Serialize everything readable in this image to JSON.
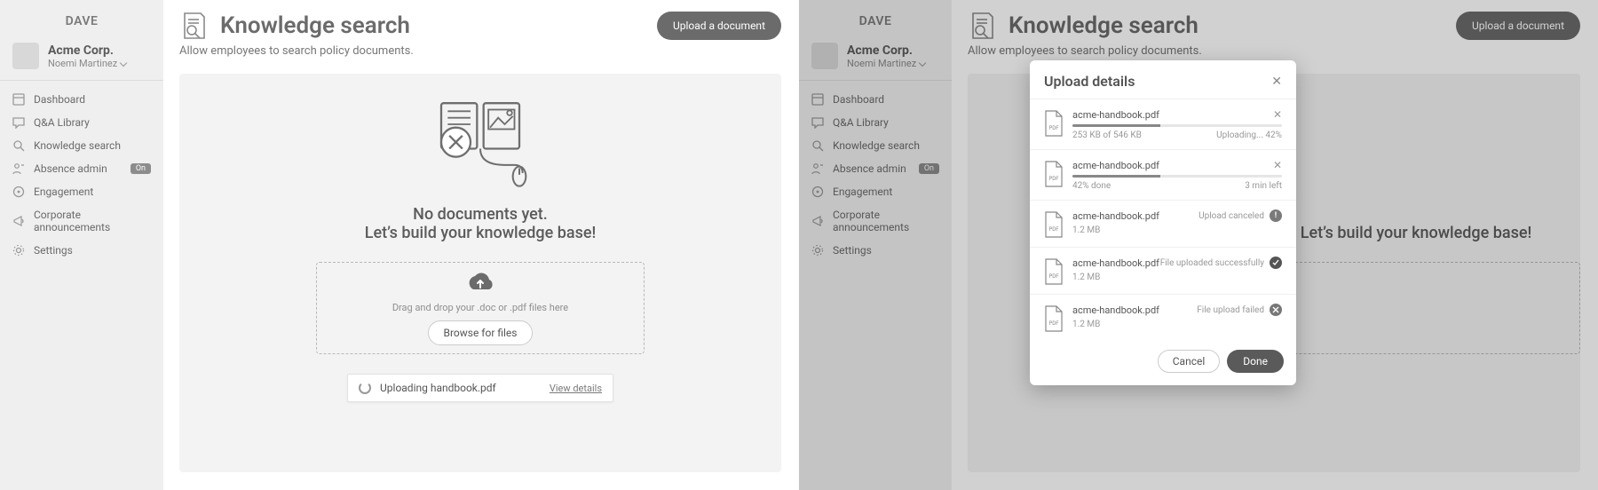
{
  "brand": "DAVE",
  "org": {
    "name": "Acme Corp.",
    "user": "Noemi Martinez"
  },
  "nav": [
    {
      "label": "Dashboard",
      "icon": "home-icon"
    },
    {
      "label": "Q&A Library",
      "icon": "qa-icon"
    },
    {
      "label": "Knowledge search",
      "icon": "search-icon"
    },
    {
      "label": "Absence admin",
      "icon": "absence-icon",
      "badge": "On"
    },
    {
      "label": "Engagement",
      "icon": "engagement-icon"
    },
    {
      "label": "Corporate announcements",
      "icon": "announcement-icon"
    },
    {
      "label": "Settings",
      "icon": "settings-icon"
    }
  ],
  "page": {
    "title": "Knowledge search",
    "upload_btn": "Upload a document",
    "subtitle": "Allow employees to search policy documents.",
    "empty_line1": "No documents yet.",
    "empty_line2": "Let’s build your knowledge base!",
    "dropzone_text": "Drag and drop your .doc or .pdf files here",
    "browse_btn": "Browse for files"
  },
  "uploading_toast": {
    "text": "Uploading handbook.pdf",
    "link": "View details"
  },
  "modal": {
    "title": "Upload details",
    "cancel": "Cancel",
    "done": "Done",
    "rows": [
      {
        "name": "acme-handbook.pdf",
        "progress": 42,
        "sub": "253 KB of 546 KB",
        "status": "Uploading... 42%",
        "cancelable": true
      },
      {
        "name": "acme-handbook.pdf",
        "progress": 42,
        "sub": "42% done",
        "status": "3 min left",
        "cancelable": true
      },
      {
        "name": "acme-handbook.pdf",
        "sub": "1.2 MB",
        "status": "Upload canceled",
        "pill": "info"
      },
      {
        "name": "acme-handbook.pdf",
        "sub": "1.2 MB",
        "status": "File uploaded successfully",
        "pill": "ok"
      },
      {
        "name": "acme-handbook.pdf",
        "sub": "1.2 MB",
        "status": "File upload failed",
        "pill": "fail"
      }
    ]
  }
}
